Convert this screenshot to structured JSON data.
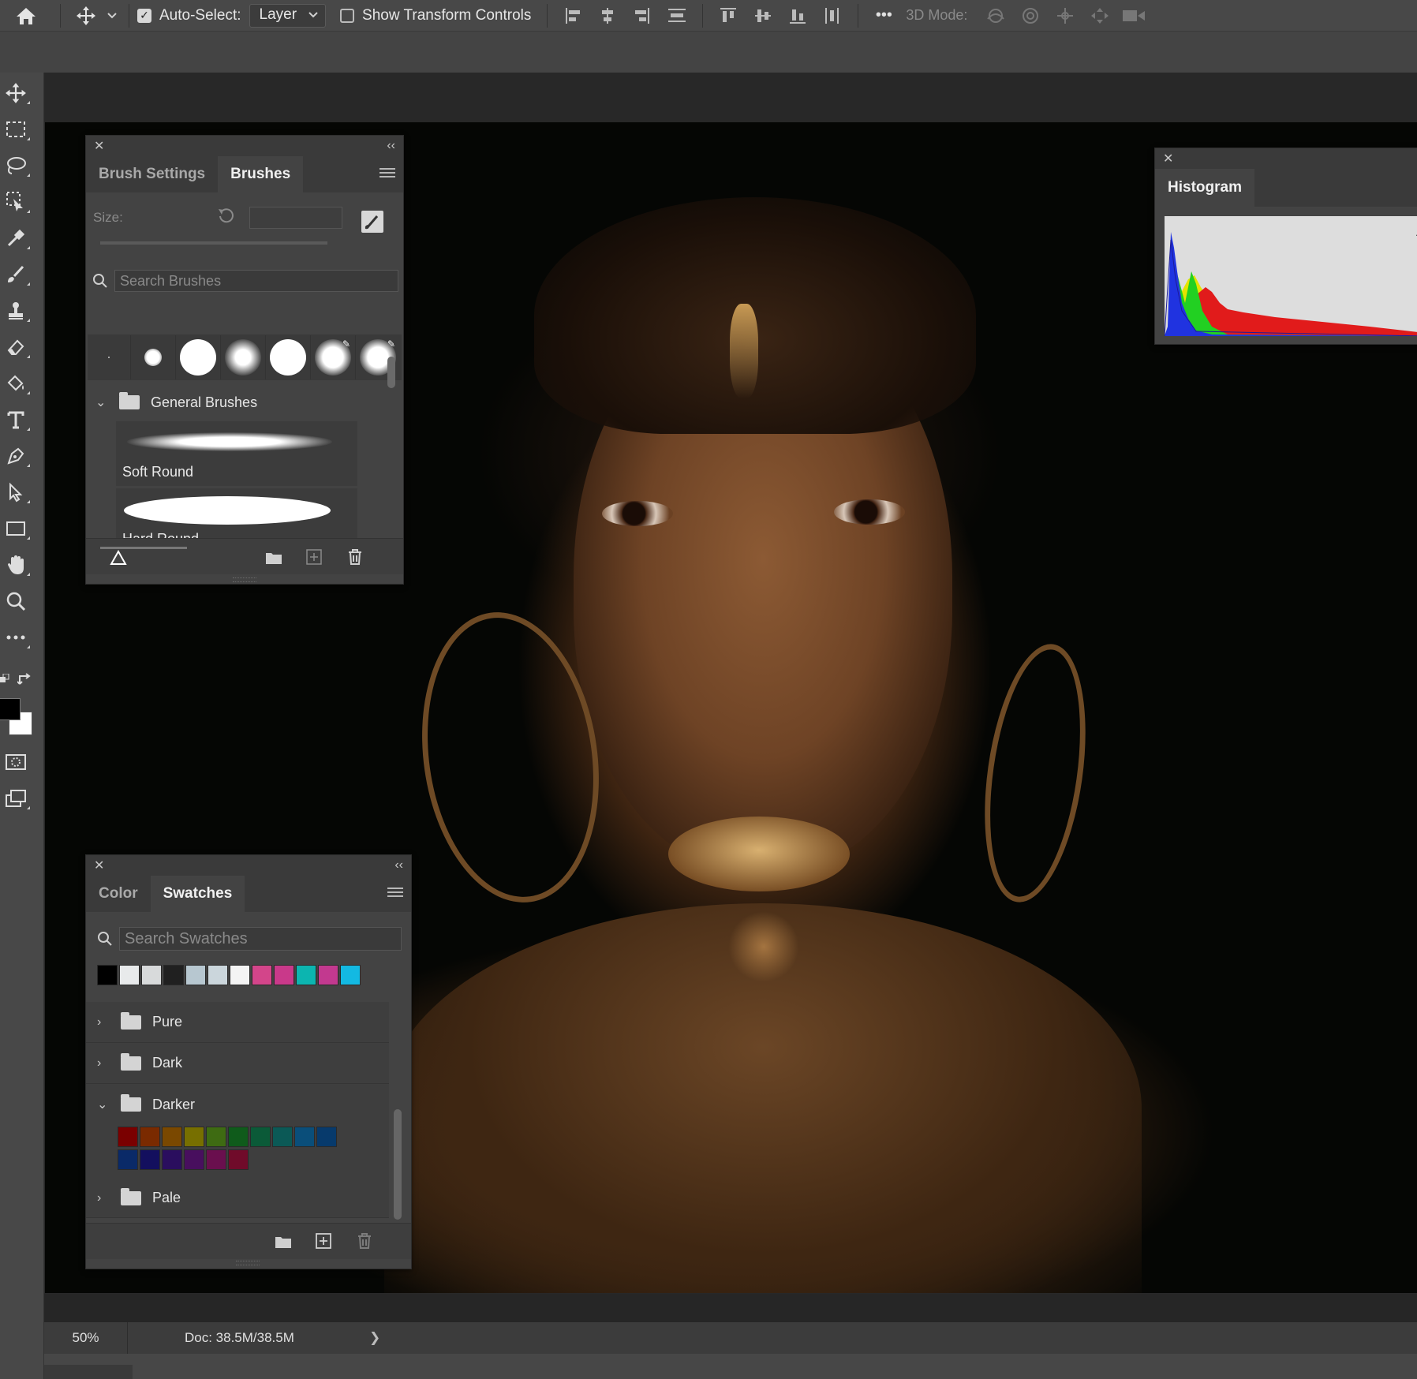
{
  "options_bar": {
    "auto_select_label": "Auto-Select:",
    "auto_select_checked": true,
    "auto_select_value": "Layer",
    "transform_controls_label": "Show Transform Controls",
    "transform_controls_checked": false,
    "more_label": "•••",
    "mode_3d_label": "3D Mode:"
  },
  "brushes_panel": {
    "tabs": [
      {
        "label": "Brush Settings",
        "active": false
      },
      {
        "label": "Brushes",
        "active": true
      }
    ],
    "size_label": "Size:",
    "size_value": "",
    "search_placeholder": "Search Brushes",
    "folder": "General Brushes",
    "brushes": [
      {
        "name": "Soft Round"
      },
      {
        "name": "Hard Round"
      }
    ]
  },
  "histogram_panel": {
    "title": "Histogram"
  },
  "swatches_panel": {
    "tabs": [
      {
        "label": "Color",
        "active": false
      },
      {
        "label": "Swatches",
        "active": true
      }
    ],
    "search_placeholder": "Search Swatches",
    "recent_swatches": [
      "#000000",
      "#e8eaeb",
      "#d8dadb",
      "#202020",
      "#b7c7d0",
      "#cbd6dc",
      "#f4f4f4",
      "#d3458a",
      "#c9398a",
      "#0cb5b0",
      "#c2398f",
      "#13b9e2"
    ],
    "folders": [
      {
        "name": "Pure",
        "expanded": false
      },
      {
        "name": "Dark",
        "expanded": false
      },
      {
        "name": "Darker",
        "expanded": true
      },
      {
        "name": "Pale",
        "expanded": false
      }
    ],
    "darker_colors_row1": [
      "#7a0000",
      "#7a2a00",
      "#7a4800",
      "#776f00",
      "#3e6b12",
      "#0f5b1b",
      "#0b5a38",
      "#0b5956",
      "#0a4e7a",
      "#073a6c"
    ],
    "darker_colors_row2": [
      "#0a2a68",
      "#130f5e",
      "#2a0e5e",
      "#480f5e",
      "#6a0f4e",
      "#700b2a"
    ]
  },
  "status_bar": {
    "zoom": "50%",
    "doc_info": "Doc: 38.5M/38.5M",
    "arrow": "❯"
  },
  "colors": {
    "foreground": "#000000",
    "background": "#ffffff"
  }
}
